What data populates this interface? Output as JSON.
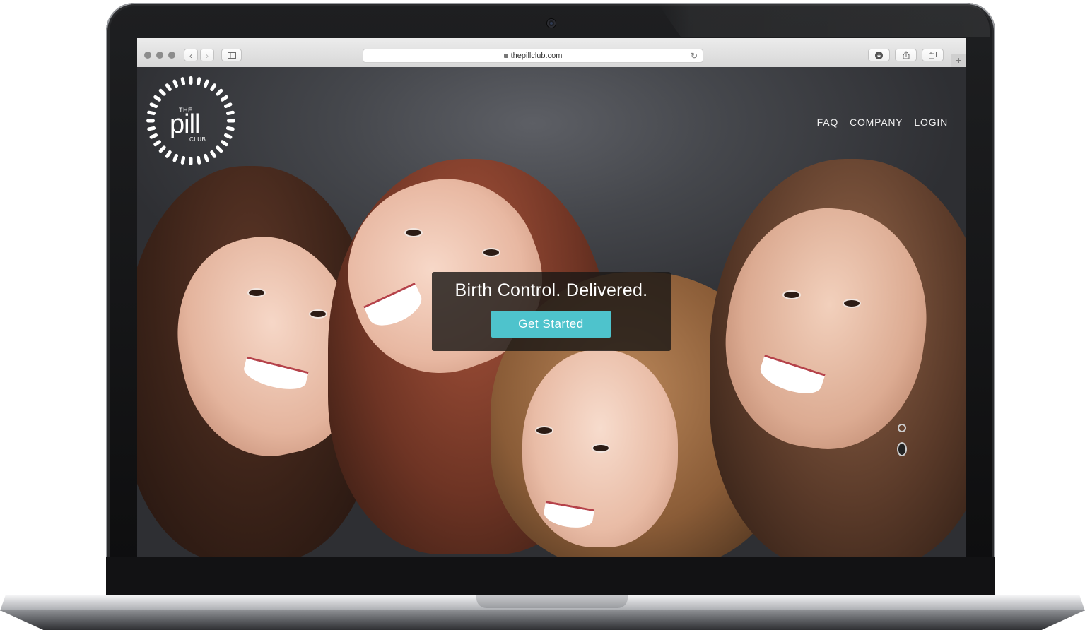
{
  "browser": {
    "url": "thepillclub.com",
    "plus_label": "+"
  },
  "site": {
    "logo": {
      "the": "THE",
      "pill": "pill",
      "club": "CLUB"
    },
    "nav": [
      "FAQ",
      "COMPANY",
      "LOGIN"
    ],
    "hero": {
      "headline": "Birth Control. Delivered.",
      "cta_label": "Get Started"
    }
  },
  "colors": {
    "cta": "#4ec3cc",
    "hero_box": "#1c1816",
    "background": "#45474c"
  }
}
